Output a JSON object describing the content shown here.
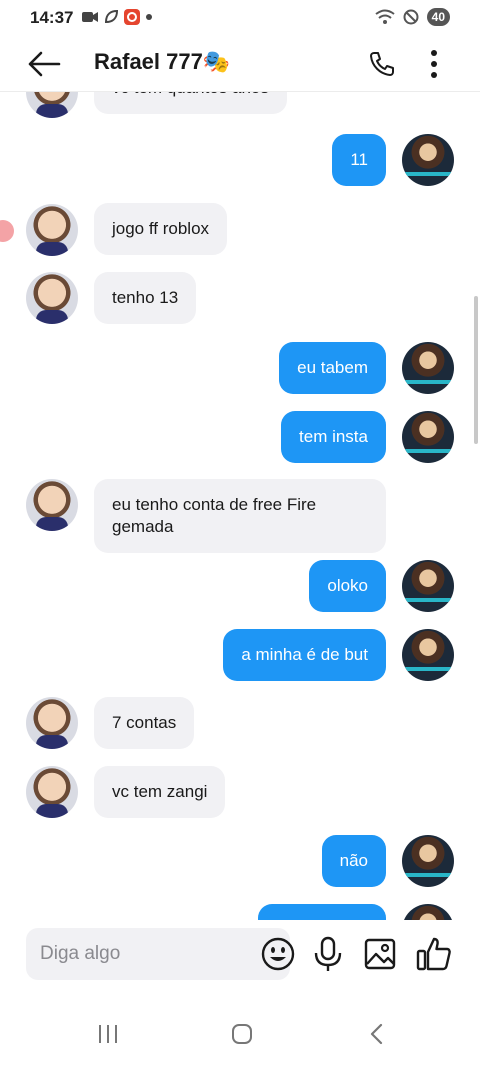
{
  "status_bar": {
    "time": "14:37",
    "battery": "40"
  },
  "header": {
    "title": "Rafael 777🎭"
  },
  "messages": [
    {
      "side": "in",
      "text": "vc tem quantos anos"
    },
    {
      "side": "out",
      "text": "11"
    },
    {
      "side": "in",
      "text": "jogo ff roblox"
    },
    {
      "side": "in",
      "text": "tenho 13"
    },
    {
      "side": "out",
      "text": "eu tabem"
    },
    {
      "side": "out",
      "text": "tem insta"
    },
    {
      "side": "in",
      "text": "eu tenho conta de free Fire\ngemada"
    },
    {
      "side": "out",
      "text": "oloko"
    },
    {
      "side": "out",
      "text": "a minha é de but"
    },
    {
      "side": "in",
      "text": "7 contas"
    },
    {
      "side": "in",
      "text": "vc tem zangi"
    },
    {
      "side": "out",
      "text": "não"
    },
    {
      "side": "out",
      "text": ""
    }
  ],
  "composer": {
    "placeholder": "Diga algo"
  },
  "icons": {
    "back": "arrow-left-icon",
    "call": "phone-icon",
    "more": "more-vertical-icon",
    "emoji": "smiley-icon",
    "mic": "microphone-icon",
    "image": "image-icon",
    "like": "thumbs-up-icon"
  },
  "colors": {
    "outgoing_bubble": "#1e96f5",
    "incoming_bubble": "#f1f1f4"
  }
}
